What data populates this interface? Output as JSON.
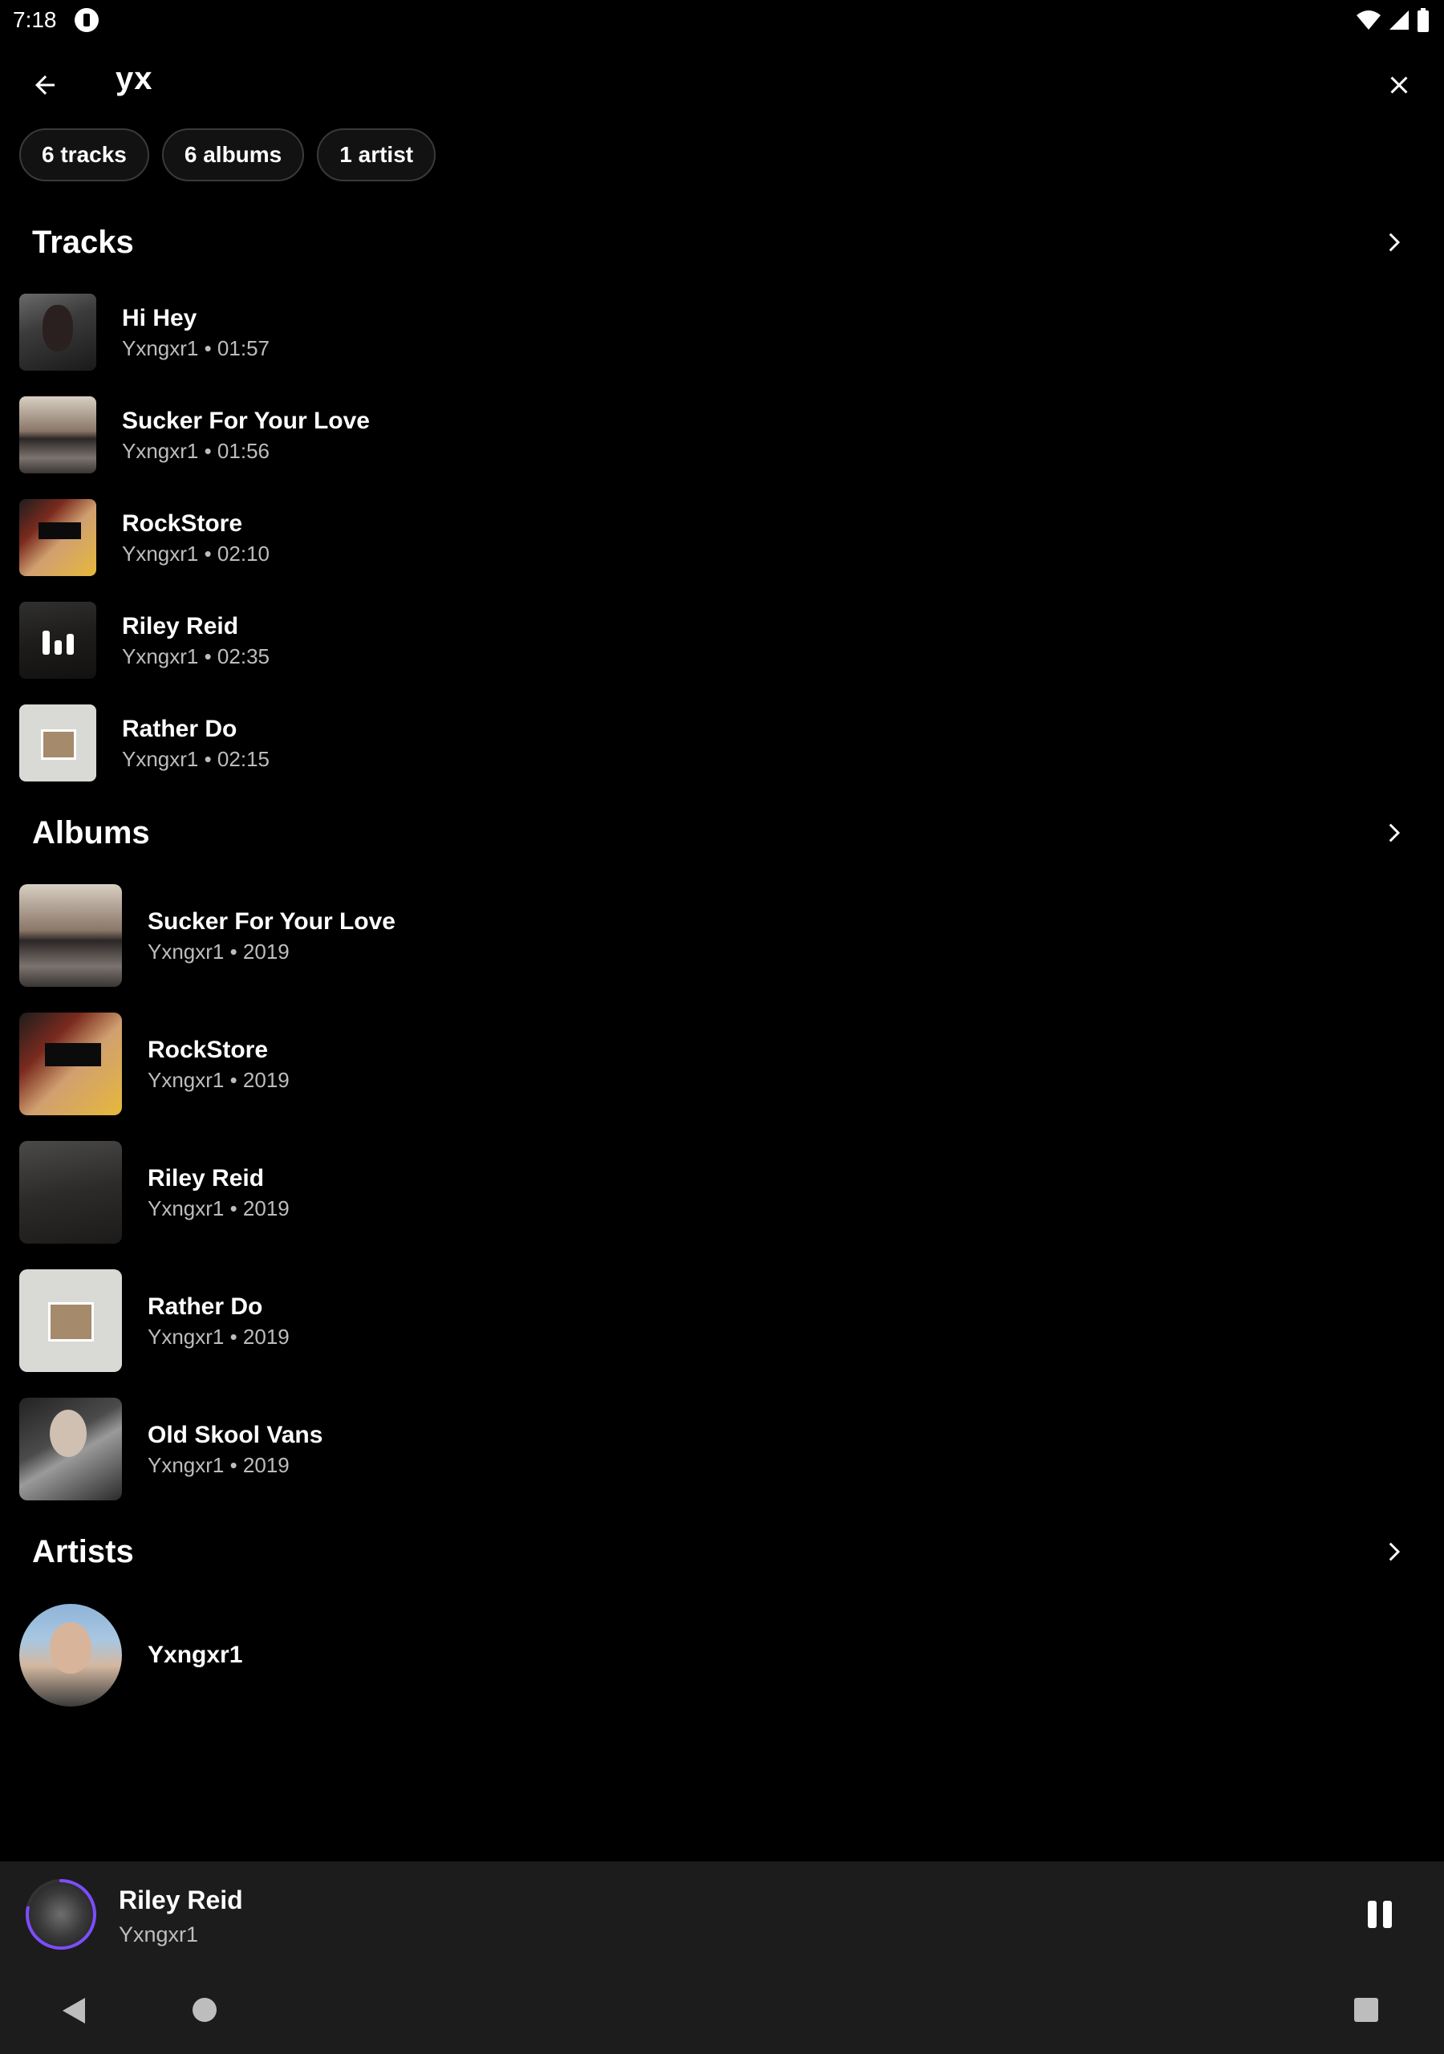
{
  "status_bar": {
    "time": "7:18"
  },
  "search": {
    "query": "yx"
  },
  "chips": [
    "6 tracks",
    "6 albums",
    "1 artist"
  ],
  "sections": {
    "tracks": "Tracks",
    "albums": "Albums",
    "artists": "Artists"
  },
  "tracks": [
    {
      "title": "Hi Hey",
      "subtitle": "Yxngxr1 • 01:57"
    },
    {
      "title": "Sucker For Your Love",
      "subtitle": "Yxngxr1 • 01:56"
    },
    {
      "title": "RockStore",
      "subtitle": "Yxngxr1 • 02:10"
    },
    {
      "title": "Riley Reid",
      "subtitle": "Yxngxr1 • 02:35"
    },
    {
      "title": "Rather Do",
      "subtitle": "Yxngxr1 • 02:15"
    }
  ],
  "albums": [
    {
      "title": "Sucker For Your Love",
      "subtitle": "Yxngxr1 • 2019"
    },
    {
      "title": "RockStore",
      "subtitle": "Yxngxr1 • 2019"
    },
    {
      "title": "Riley Reid",
      "subtitle": "Yxngxr1 • 2019"
    },
    {
      "title": "Rather Do",
      "subtitle": "Yxngxr1 • 2019"
    },
    {
      "title": "Old Skool Vans",
      "subtitle": "Yxngxr1 • 2019"
    }
  ],
  "artists": [
    {
      "name": "Yxngxr1"
    }
  ],
  "now_playing": {
    "title": "Riley Reid",
    "artist": "Yxngxr1",
    "progress": 0.78
  },
  "colors": {
    "background": "#000000",
    "player_bar": "#1c1c1c",
    "accent_ring": "#7c4dff",
    "secondary_text": "#bdbdbd"
  },
  "icons": {
    "back": "arrow-left-icon",
    "close": "close-icon",
    "chevron": "chevron-right-icon",
    "pause": "pause-icon",
    "now_playing_indicator": "equalizer-icon"
  }
}
